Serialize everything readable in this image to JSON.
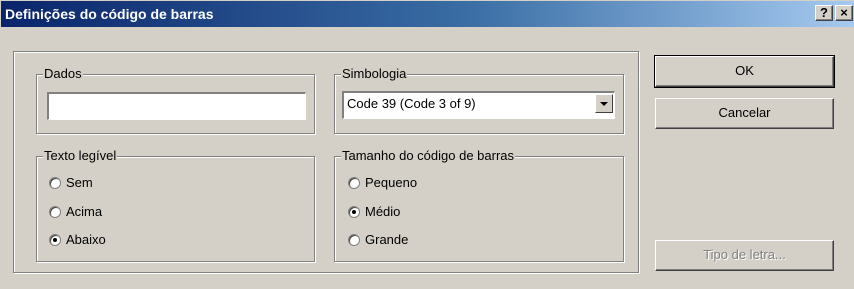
{
  "window": {
    "title": "Definições do código de barras"
  },
  "titlebar_buttons": {
    "help": "?",
    "close": "×"
  },
  "dados": {
    "label": "Dados",
    "value": ""
  },
  "simbologia": {
    "label": "Simbologia",
    "selected": "Code 39 (Code 3 of 9)"
  },
  "texto_legivel": {
    "label": "Texto legível",
    "options": [
      {
        "label": "Sem",
        "checked": false
      },
      {
        "label": "Acima",
        "checked": false
      },
      {
        "label": "Abaixo",
        "checked": true
      }
    ]
  },
  "tamanho": {
    "label": "Tamanho do código de barras",
    "options": [
      {
        "label": "Pequeno",
        "checked": false
      },
      {
        "label": "Médio",
        "checked": true
      },
      {
        "label": "Grande",
        "checked": false
      }
    ]
  },
  "buttons": {
    "ok": "OK",
    "cancel": "Cancelar",
    "font": "Tipo de letra..."
  }
}
